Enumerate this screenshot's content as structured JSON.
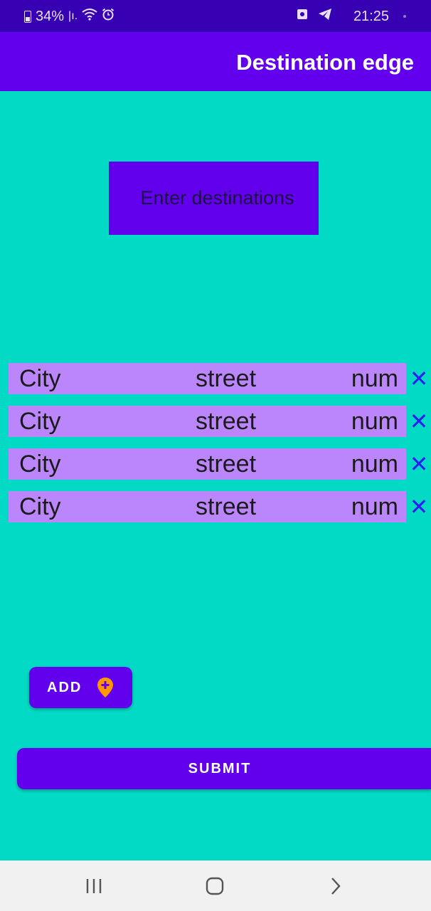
{
  "status_bar": {
    "battery": "34%",
    "time": "21:25"
  },
  "app_bar": {
    "title": "Destination edge"
  },
  "header_box": {
    "label": "Enter destinations"
  },
  "destinations": [
    {
      "city": "City",
      "street": "street",
      "num": "num",
      "remove": "✕"
    },
    {
      "city": "City",
      "street": "street",
      "num": "num",
      "remove": "✕"
    },
    {
      "city": "City",
      "street": "street",
      "num": "num",
      "remove": "✕"
    },
    {
      "city": "City",
      "street": "street",
      "num": "num",
      "remove": "✕"
    }
  ],
  "actions": {
    "add_label": "ADD",
    "submit_label": "SUBMIT"
  },
  "colors": {
    "background": "#03dac5",
    "primary": "#6200ee",
    "primary_dark": "#3700b3",
    "row": "#bb86fc",
    "remove_icon": "#2a1ff0",
    "pin_icon": "#ff9800"
  },
  "icons": {
    "add_button": "add-location-icon",
    "remove": "close-icon",
    "nav": [
      "recent-apps-icon",
      "home-icon",
      "back-icon"
    ]
  }
}
